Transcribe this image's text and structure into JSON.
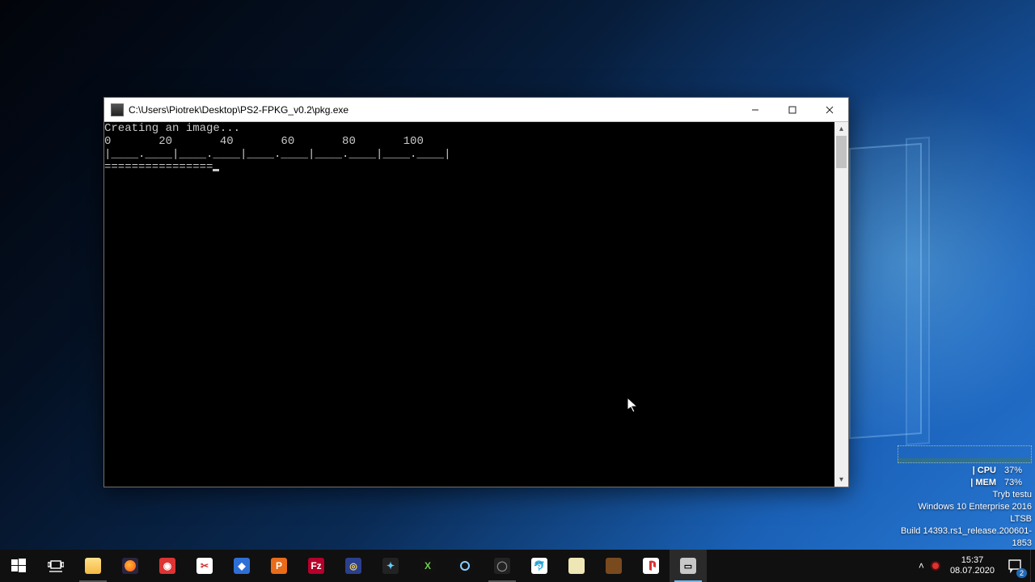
{
  "window": {
    "title": "C:\\Users\\Piotrek\\Desktop\\PS2-FPKG_v0.2\\pkg.exe",
    "buttons": {
      "minimize": "Minimize",
      "maximize": "Maximize",
      "close": "Close"
    }
  },
  "terminal": {
    "line1": "Creating an image...",
    "line2": "0       20       40       60       80       100",
    "line3": "|____.____|____.____|____.____|____.____|____.____|",
    "line4": "================"
  },
  "overlay": {
    "cpu_label": "| CPU",
    "cpu_value": "37%",
    "mem_label": "| MEM",
    "mem_value": "73%",
    "line1": "Tryb testu",
    "line2": "Windows 10 Enterprise 2016 LTSB",
    "line3": "Build 14393.rs1_release.200601-1853"
  },
  "tray": {
    "time": "15:37",
    "date": "08.07.2020",
    "notification_count": "2"
  },
  "taskbar": {
    "items": [
      {
        "name": "start-button",
        "label": "Start"
      },
      {
        "name": "task-view-button",
        "label": "Task View"
      },
      {
        "name": "file-explorer",
        "label": "File Explorer"
      },
      {
        "name": "firefox",
        "label": "Firefox"
      },
      {
        "name": "app-red",
        "label": "App"
      },
      {
        "name": "snipping-tool",
        "label": "Snipping Tool"
      },
      {
        "name": "app-blue-diamond",
        "label": "App"
      },
      {
        "name": "app-orange",
        "label": "App"
      },
      {
        "name": "filezilla",
        "label": "FileZilla"
      },
      {
        "name": "imgburn",
        "label": "ImgBurn"
      },
      {
        "name": "emulator-ps1",
        "label": "Emulator"
      },
      {
        "name": "emulator-xbox",
        "label": "Emulator"
      },
      {
        "name": "emulator-gc",
        "label": "Emulator"
      },
      {
        "name": "obs",
        "label": "OBS"
      },
      {
        "name": "dolphin",
        "label": "Dolphin"
      },
      {
        "name": "notepad",
        "label": "Notepad"
      },
      {
        "name": "app-brown",
        "label": "App"
      },
      {
        "name": "playstation",
        "label": "PlayStation"
      },
      {
        "name": "cmd-window",
        "label": "pkg.exe"
      }
    ]
  }
}
